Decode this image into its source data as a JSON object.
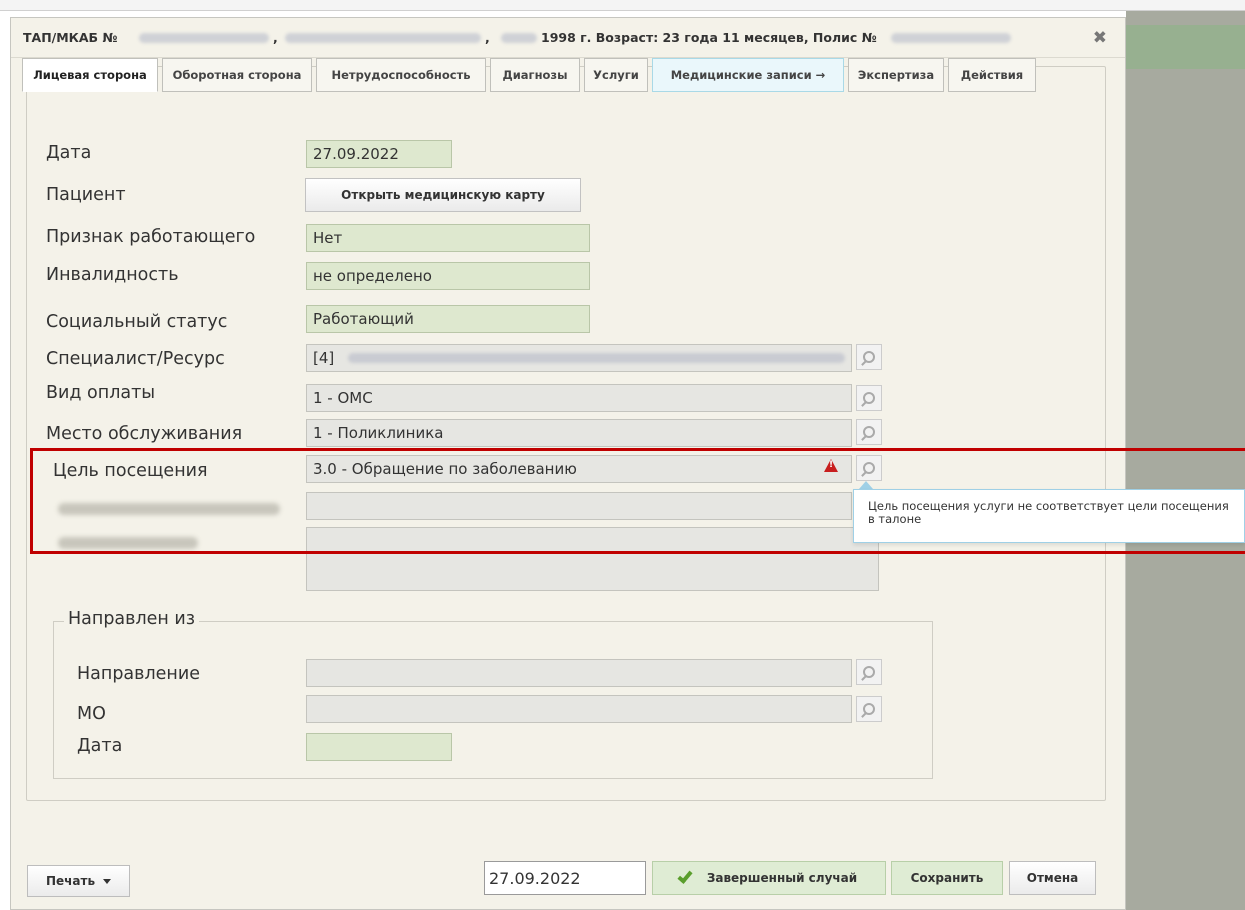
{
  "dialog": {
    "title_prefix": "ТАП/МКАБ №",
    "title_comma1": ",",
    "title_comma2": ",",
    "title_birth_age": "1998 г. Возраст: 23 года 11 месяцев, Полис №"
  },
  "tabs": [
    {
      "label": "Лицевая сторона"
    },
    {
      "label": "Оборотная сторона"
    },
    {
      "label": "Нетрудоспособность"
    },
    {
      "label": "Диагнозы"
    },
    {
      "label": "Услуги"
    },
    {
      "label": "Медицинские записи →"
    },
    {
      "label": "Экспертиза"
    },
    {
      "label": "Действия"
    }
  ],
  "form": {
    "date_label": "Дата",
    "date_value": "27.09.2022",
    "patient_label": "Пациент",
    "open_card_button": "Открыть медицинскую карту",
    "working_label": "Признак работающего",
    "working_value": "Нет",
    "disability_label": "Инвалидность",
    "disability_value": "не определено",
    "social_label": "Социальный статус",
    "social_value": "Работающий",
    "specialist_label": "Специалист/Ресурс",
    "specialist_value": "[4]",
    "payment_label": "Вид оплаты",
    "payment_value": "1 - ОМС",
    "place_label": "Место обслуживания",
    "place_value": "1 - Поликлиника",
    "purpose_label": "Цель посещения",
    "purpose_value": "3.0 - Обращение по заболеванию"
  },
  "tooltip": {
    "text": "Цель посещения услуги не соответствует цели посещения в талоне"
  },
  "referral": {
    "legend": "Направлен из",
    "direction_label": "Направление",
    "mo_label": "МО",
    "date_label": "Дата"
  },
  "footer": {
    "print_button": "Печать",
    "date_value": "27.09.2022",
    "completed_button": "Завершенный случай",
    "save_button": "Сохранить",
    "cancel_button": "Отмена"
  },
  "colors": {
    "highlight": "#c00000",
    "warning": "#c81e1e",
    "field_green": "#dee8cf"
  }
}
